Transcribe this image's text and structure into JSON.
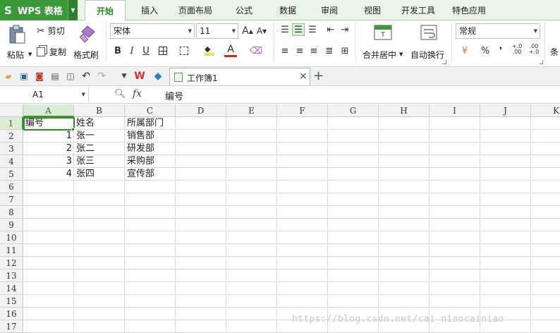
{
  "app": {
    "name": "WPS 表格",
    "logo": "S"
  },
  "menu_tabs": [
    {
      "label": "开始",
      "active": true
    },
    {
      "label": "插入",
      "active": false
    },
    {
      "label": "页面布局",
      "active": false
    },
    {
      "label": "公式",
      "active": false
    },
    {
      "label": "数据",
      "active": false
    },
    {
      "label": "审阅",
      "active": false
    },
    {
      "label": "视图",
      "active": false
    },
    {
      "label": "开发工具",
      "active": false
    },
    {
      "label": "特色应用",
      "active": false
    }
  ],
  "ribbon": {
    "paste_label": "粘贴",
    "cut_label": "剪切",
    "copy_label": "复制",
    "format_painter_label": "格式刷",
    "font_name": "宋体",
    "font_size": "11",
    "bold": "B",
    "italic": "I",
    "underline": "U",
    "font_color_glyph": "A",
    "merge_center_label": "合并居中",
    "wrap_text_label": "自动换行",
    "number_format": "常规",
    "percent_glyph": "%",
    "comma_glyph": "❜",
    "increase_decimal": "+.0\n.00",
    "decrease_decimal": ".00\n+.0",
    "cond_label": "条"
  },
  "document": {
    "tab_title": "工作簿1"
  },
  "formula_bar": {
    "cell_ref": "A1",
    "fx": "fx",
    "value": "编号"
  },
  "sheet": {
    "columns": [
      "A",
      "B",
      "C",
      "D",
      "E",
      "F",
      "G",
      "H",
      "I",
      "J",
      "K"
    ],
    "rows": [
      "1",
      "2",
      "3",
      "4",
      "5",
      "6",
      "7",
      "8",
      "9",
      "10",
      "11",
      "12",
      "13",
      "14",
      "15",
      "16",
      "17"
    ],
    "data": [
      [
        "编号",
        "姓名",
        "所属部门"
      ],
      [
        "1",
        "张一",
        "销售部"
      ],
      [
        "2",
        "张二",
        "研发部"
      ],
      [
        "3",
        "张三",
        "采购部"
      ],
      [
        "4",
        "张四",
        "宣传部"
      ]
    ],
    "active_cell": "A1"
  },
  "watermark": "https://blog.csdn.net/cai_niaocainiao",
  "colors": {
    "accent": "#3d9a3a",
    "menubar_bg": "#e9f3e6",
    "selection": "#2f8f2d"
  }
}
